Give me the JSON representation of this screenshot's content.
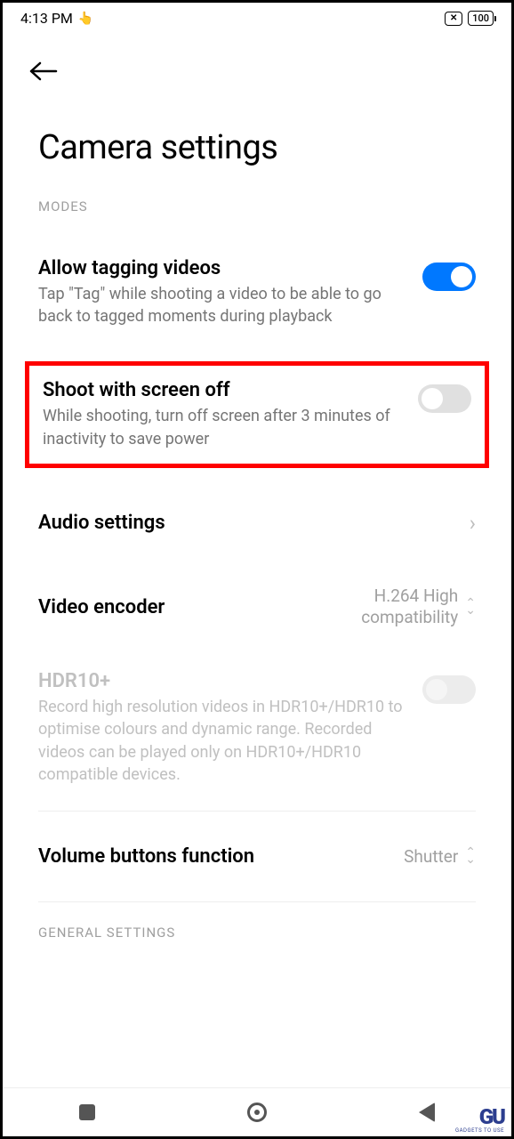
{
  "status": {
    "time": "4:13 PM",
    "battery": "100"
  },
  "header": {
    "title": "Camera settings"
  },
  "sections": {
    "modes": {
      "label": "MODES"
    },
    "general": {
      "label": "GENERAL SETTINGS"
    }
  },
  "settings": {
    "tagging": {
      "title": "Allow tagging videos",
      "desc": "Tap \"Tag\" while shooting a video to be able to go back to tagged moments during playback"
    },
    "screen_off": {
      "title": "Shoot with screen off",
      "desc": "While shooting, turn off screen after 3 minutes of inactivity to save power"
    },
    "audio": {
      "title": "Audio settings"
    },
    "encoder": {
      "title": "Video encoder",
      "value": "H.264 High compatibility"
    },
    "hdr": {
      "title": "HDR10+",
      "desc": "Record high resolution videos in HDR10+/HDR10 to optimise colours and dynamic range. Recorded videos can be played only on HDR10+/HDR10 compatible devices."
    },
    "volume": {
      "title": "Volume buttons function",
      "value": "Shutter"
    }
  },
  "watermark": {
    "logo": "GU",
    "text": "GADGETS TO USE"
  }
}
